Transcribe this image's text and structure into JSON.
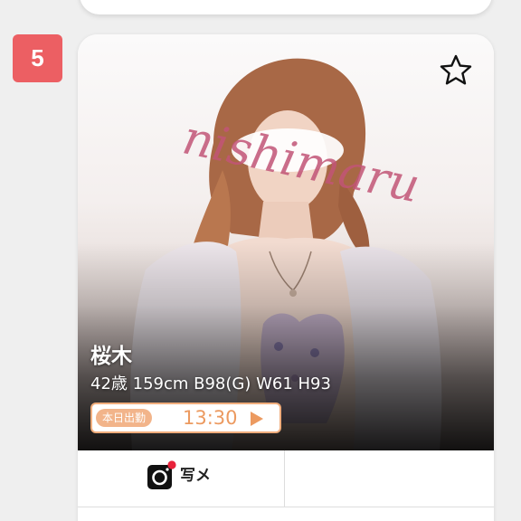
{
  "rank": "5",
  "profile": {
    "name": "桜木",
    "stats": "42歳 159cm B98(G) W61 H93",
    "watermark": "nishimaru"
  },
  "shift": {
    "label": "本日出勤",
    "time": "13:30"
  },
  "actions": {
    "photo_label": "写メ"
  },
  "icons": {
    "favorite": "star-outline-icon",
    "photo_diary": "camera-icon",
    "shift_link": "play-arrow-icon"
  },
  "colors": {
    "rank_badge": "#ec5f63",
    "shift_accent": "#ec9a60",
    "shift_label_bg": "#f2b48a",
    "watermark": "#c25577"
  }
}
